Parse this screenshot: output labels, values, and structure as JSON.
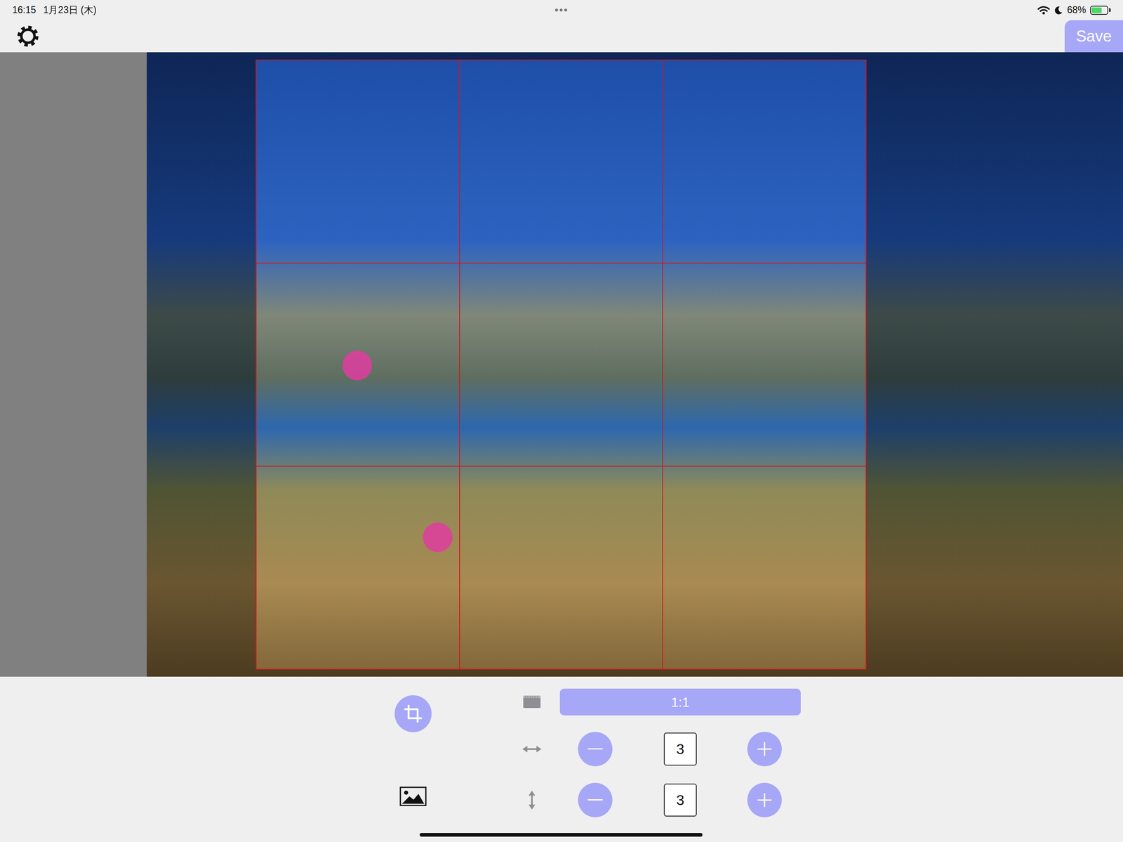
{
  "status_bar": {
    "time": "16:15",
    "date": "1月23日 (木)",
    "dots": "•••",
    "battery": "68%",
    "battery_level": 0.68,
    "charging": true
  },
  "toolbar": {
    "save": "Save"
  },
  "tools": [
    {
      "kind": "crop",
      "selected": true
    },
    {
      "kind": "image",
      "selected": false
    }
  ],
  "crop": {
    "aspect": "1:1",
    "columns": "3",
    "rows": "3"
  }
}
